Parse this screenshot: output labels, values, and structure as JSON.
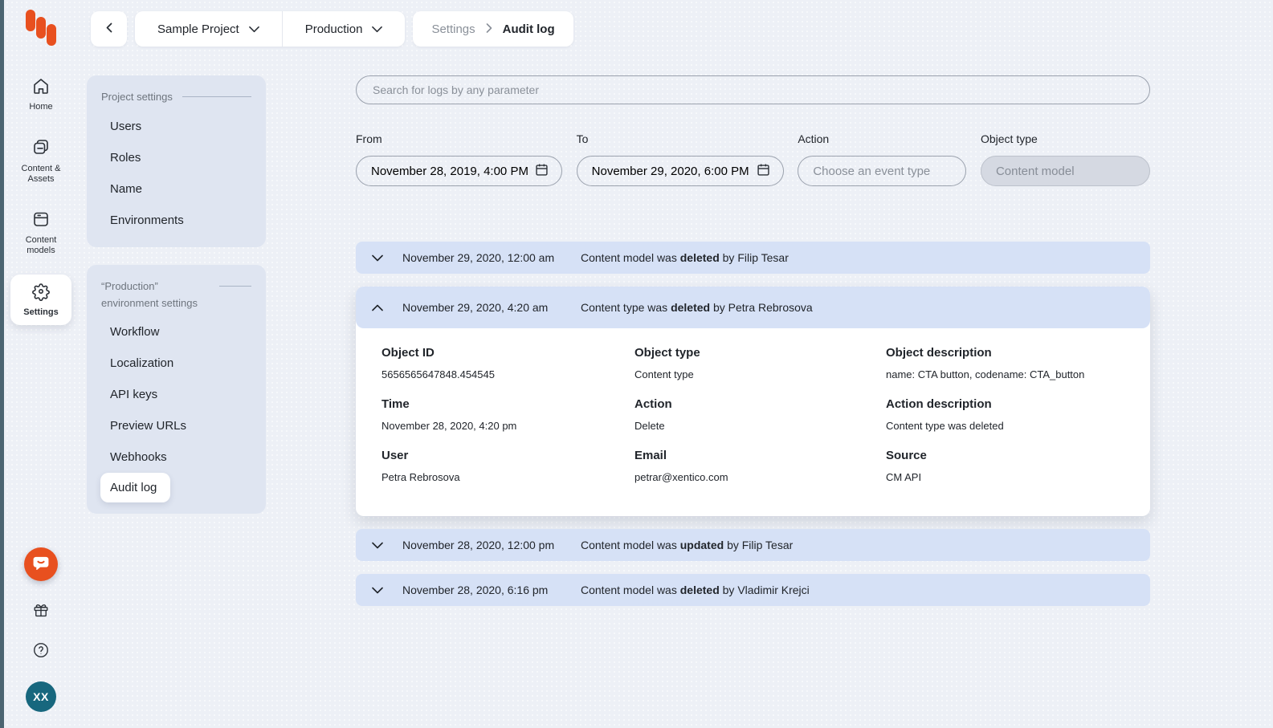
{
  "colors": {
    "accent": "#e8501f",
    "page_bg": "#edf0f6",
    "panel_bg": "#dfe5f1",
    "row_bg": "#d6e1f6",
    "avatar_bg": "#17677e",
    "edge_strip": "#4b6471"
  },
  "topbar": {
    "project_selector": "Sample Project",
    "environment_selector": "Production",
    "breadcrumb": {
      "parent": "Settings",
      "current": "Audit log"
    }
  },
  "sidebar": {
    "items": [
      {
        "id": "home",
        "icon": "home",
        "label": "Home",
        "active": false
      },
      {
        "id": "content-assets",
        "icon": "content-assets",
        "label": "Content & Assets",
        "active": false
      },
      {
        "id": "content-models",
        "icon": "content-models",
        "label": "Content models",
        "active": false
      },
      {
        "id": "settings",
        "icon": "settings",
        "label": "Settings",
        "active": true
      }
    ],
    "avatar_initials": "XX"
  },
  "settings_nav": {
    "project_group": {
      "title": "Project settings",
      "items": [
        "Users",
        "Roles",
        "Name",
        "Environments"
      ]
    },
    "environment_group": {
      "title": "“Production” environment settings",
      "items": [
        "Workflow",
        "Localization",
        "API keys",
        "Preview URLs",
        "Webhooks",
        "Audit log"
      ],
      "active_item": "Audit log"
    }
  },
  "filters": {
    "search_placeholder": "Search for logs by any parameter",
    "from": {
      "label": "From",
      "value": "November 28, 2019, 4:00 PM"
    },
    "to": {
      "label": "To",
      "value": "November 29, 2020, 6:00 PM"
    },
    "action": {
      "label": "Action",
      "placeholder": "Choose an event type"
    },
    "object_type": {
      "label": "Object type",
      "value": "Content model"
    }
  },
  "log": {
    "entries": [
      {
        "timestamp": "November 29, 2020, 12:00 am",
        "message_prefix": "Content model was ",
        "action_word": "deleted",
        "message_suffix": " by Filip Tesar",
        "expanded": false
      },
      {
        "timestamp": "November 29, 2020, 4:20 am",
        "message_prefix": "Content type was ",
        "action_word": "deleted",
        "message_suffix": " by Petra Rebrosova",
        "expanded": true,
        "details": [
          {
            "label": "Object ID",
            "value": "5656565647848.454545"
          },
          {
            "label": "Object type",
            "value": "Content type"
          },
          {
            "label": "Object description",
            "value": "name: CTA button, codename: CTA_button"
          },
          {
            "label": "Time",
            "value": "November 28, 2020, 4:20 pm"
          },
          {
            "label": "Action",
            "value": "Delete"
          },
          {
            "label": "Action description",
            "value": "Content type was deleted"
          },
          {
            "label": "User",
            "value": "Petra Rebrosova"
          },
          {
            "label": "Email",
            "value": "petrar@xentico.com"
          },
          {
            "label": "Source",
            "value": "CM API"
          }
        ]
      },
      {
        "timestamp": "November 28, 2020, 12:00 pm",
        "message_prefix": "Content model was ",
        "action_word": "updated",
        "message_suffix": " by Filip Tesar",
        "expanded": false
      },
      {
        "timestamp": "November 28, 2020, 6:16 pm",
        "message_prefix": "Content model was ",
        "action_word": "deleted",
        "message_suffix": " by Vladimir Krejci",
        "expanded": false
      }
    ]
  }
}
